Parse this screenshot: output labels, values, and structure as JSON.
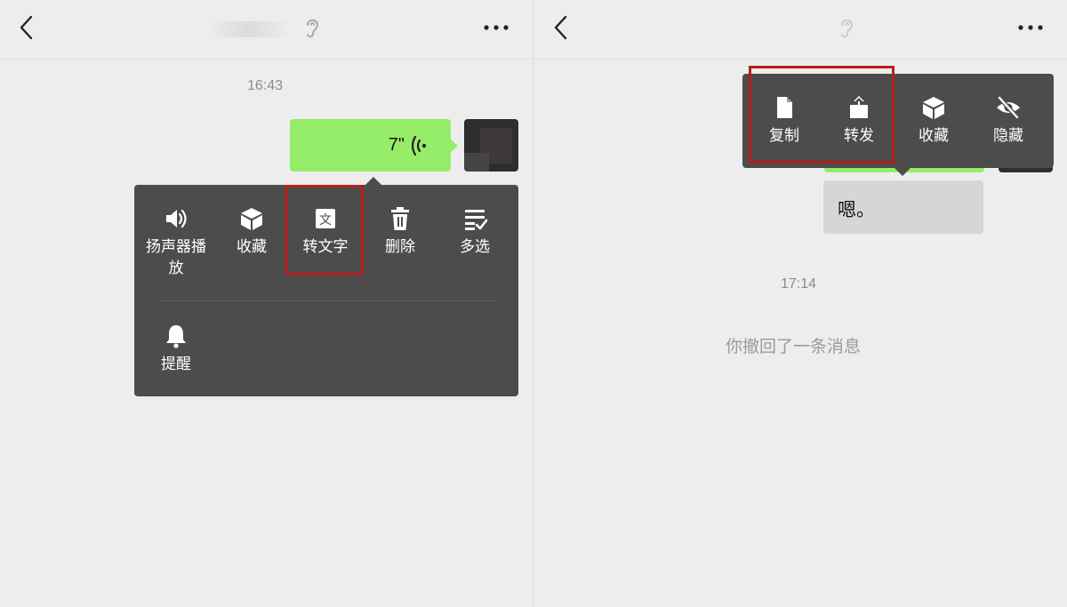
{
  "left": {
    "timestamp": "16:43",
    "voice_duration": "7\"",
    "menu_items": [
      "扬声器播放",
      "收藏",
      "转文字",
      "删除",
      "多选",
      "提醒"
    ],
    "menu_icons": [
      "speaker-icon",
      "cube-icon",
      "text-icon",
      "trash-icon",
      "multiselect-icon",
      "bell-icon"
    ],
    "text_icon_glyph": "文"
  },
  "right": {
    "menu_items": [
      "复制",
      "转发",
      "收藏",
      "隐藏"
    ],
    "menu_icons": [
      "document-icon",
      "share-icon",
      "cube-icon",
      "eye-slash-icon"
    ],
    "message_text": "嗯。",
    "timestamp": "17:14",
    "recall_notice": "你撤回了一条消息"
  },
  "colors": {
    "background": "#ededed",
    "menu": "#4c4c4c",
    "green_bubble": "#95ec69",
    "highlight": "#b51e1e"
  }
}
